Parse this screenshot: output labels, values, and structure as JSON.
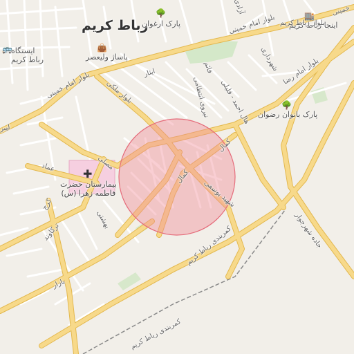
{
  "map": {
    "city_label": "رباط کریم",
    "colors": {
      "background": "#f2efe9",
      "major_road": "#f7d98a",
      "road_casing": "#e3b84e",
      "minor_road": "#ffffff",
      "hospital": "#f6cfe0",
      "park": "#cfe6c3",
      "circle_fill": "#f08a96",
      "railway": "#8a8a8a"
    },
    "pois": [
      {
        "id": "park-arghavan",
        "label": "پارک ارغوان",
        "icon": "tree-icon"
      },
      {
        "id": "paasaj",
        "label": "پاساژ ولیعصر",
        "icon": "shopping-bag-icon"
      },
      {
        "id": "station",
        "label": "ایستگاه\nرباط کریم",
        "icon": "bus-icon"
      },
      {
        "id": "injaa",
        "label": "اینجا رباط کریم",
        "icon": "shop-icon"
      },
      {
        "id": "park-banovan",
        "label": "پارک بانوان رضوان",
        "icon": "tree-icon"
      },
      {
        "id": "hospital",
        "label": "بیمارستان حضرت\nفاطمه زهرا (س)",
        "icon": "hospital-cross-icon"
      }
    ],
    "roads": [
      {
        "id": "blvd-khomeini-top",
        "label": "بلوار امام خمینی"
      },
      {
        "id": "blvd-khomeini-left",
        "label": "بلوار امام خمینی"
      },
      {
        "id": "blvd-reza",
        "label": "بلوار امام رضا"
      },
      {
        "id": "blvd-rk",
        "label": "بلوار رباط کریم"
      },
      {
        "id": "khomeini-tr",
        "label": "خمینی"
      },
      {
        "id": "shahrdari",
        "label": "شهرداری"
      },
      {
        "id": "azadi",
        "label": "آزادی"
      },
      {
        "id": "isar",
        "label": "ایثار"
      },
      {
        "id": "blvd-maleki",
        "label": "بلوار ملکی"
      },
      {
        "id": "mosalla",
        "label": "مصلی"
      },
      {
        "id": "emad",
        "label": "عماد"
      },
      {
        "id": "karaj",
        "label": "کرج"
      },
      {
        "id": "torkaband",
        "label": "ترکاوند"
      },
      {
        "id": "beheshti",
        "label": "بهشتی"
      },
      {
        "id": "bazar",
        "label": "بازار"
      },
      {
        "id": "kamal1",
        "label": "کمال"
      },
      {
        "id": "kamal2",
        "label": "کمال"
      },
      {
        "id": "shahid-yousefi",
        "label": "شهید یوسفی"
      },
      {
        "id": "jahed",
        "label": "هال احمد - فلیلی"
      },
      {
        "id": "qaem",
        "label": "قائم"
      },
      {
        "id": "entezami",
        "label": "نیروی انتظامی"
      },
      {
        "id": "kamarbandi1",
        "label": "کمربندی رباط کریم"
      },
      {
        "id": "kamarbandi2",
        "label": "کمربندی رباط کریم"
      },
      {
        "id": "jadeh",
        "label": "جاده شهرجوار"
      },
      {
        "id": "lib",
        "label": "لیبر"
      }
    ]
  }
}
